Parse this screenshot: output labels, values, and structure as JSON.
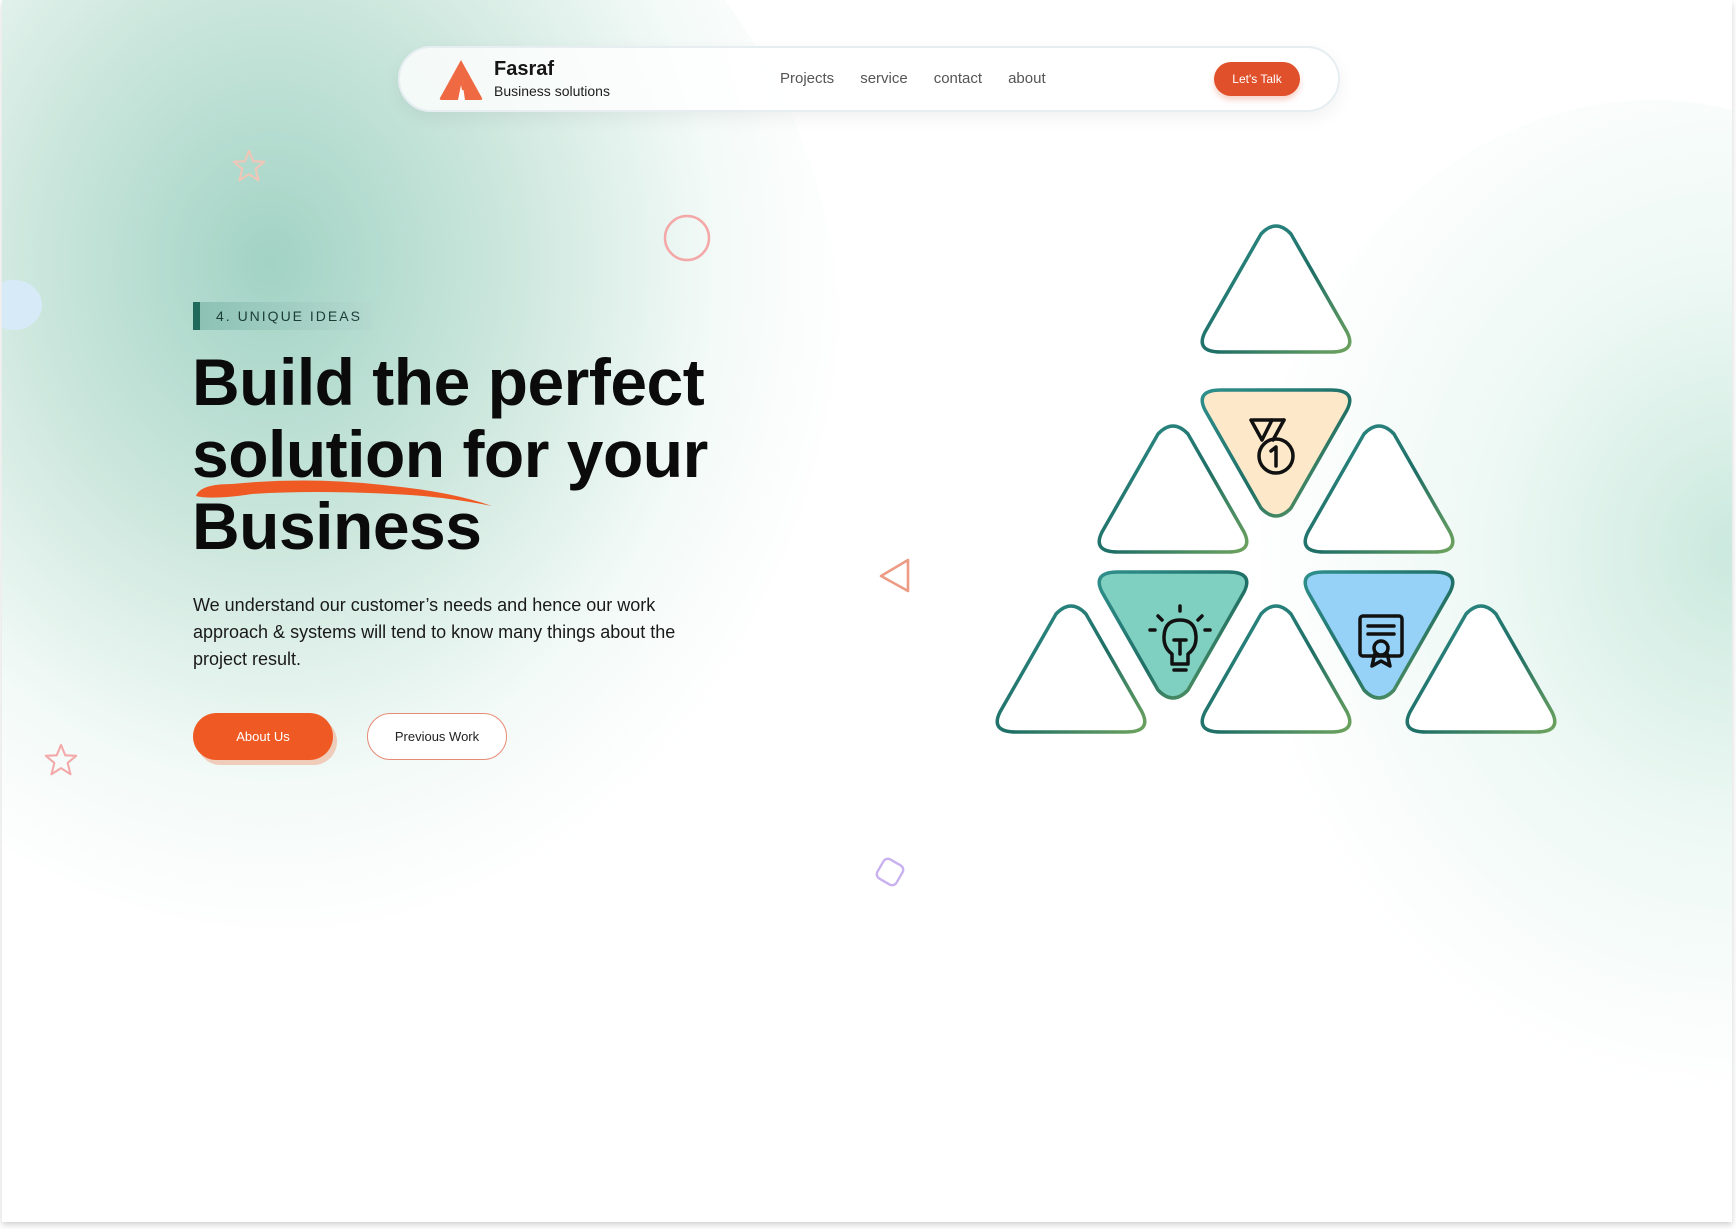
{
  "brand": {
    "name": "Fasraf",
    "tagline": "Business solutions"
  },
  "nav": {
    "items": [
      {
        "label": "Projects"
      },
      {
        "label": "service"
      },
      {
        "label": "contact"
      },
      {
        "label": "about"
      }
    ],
    "cta_label": "Let's Talk"
  },
  "hero": {
    "badge": "4. UNIQUE IDEAS",
    "headline": [
      "Build the perfect",
      "solution for your",
      "Business"
    ],
    "description": "We understand our customer’s needs and hence our work approach & systems will tend to know many things about the project result.",
    "primary_button": "About Us",
    "secondary_button": "Previous Work"
  },
  "illustration": {
    "icons": [
      "medal-icon",
      "lightbulb-icon",
      "certificate-icon"
    ],
    "fill_colors": {
      "medal": "#fde9c9",
      "lightbulb": "#7fd0c0",
      "certificate": "#96d2f8"
    }
  },
  "colors": {
    "accent": "#ef5a24",
    "nav_cta": "#e0502a",
    "badge_bar": "#1f6a5a",
    "outline_teal": "#2e8a86",
    "outline_green": "#6ea35e"
  }
}
